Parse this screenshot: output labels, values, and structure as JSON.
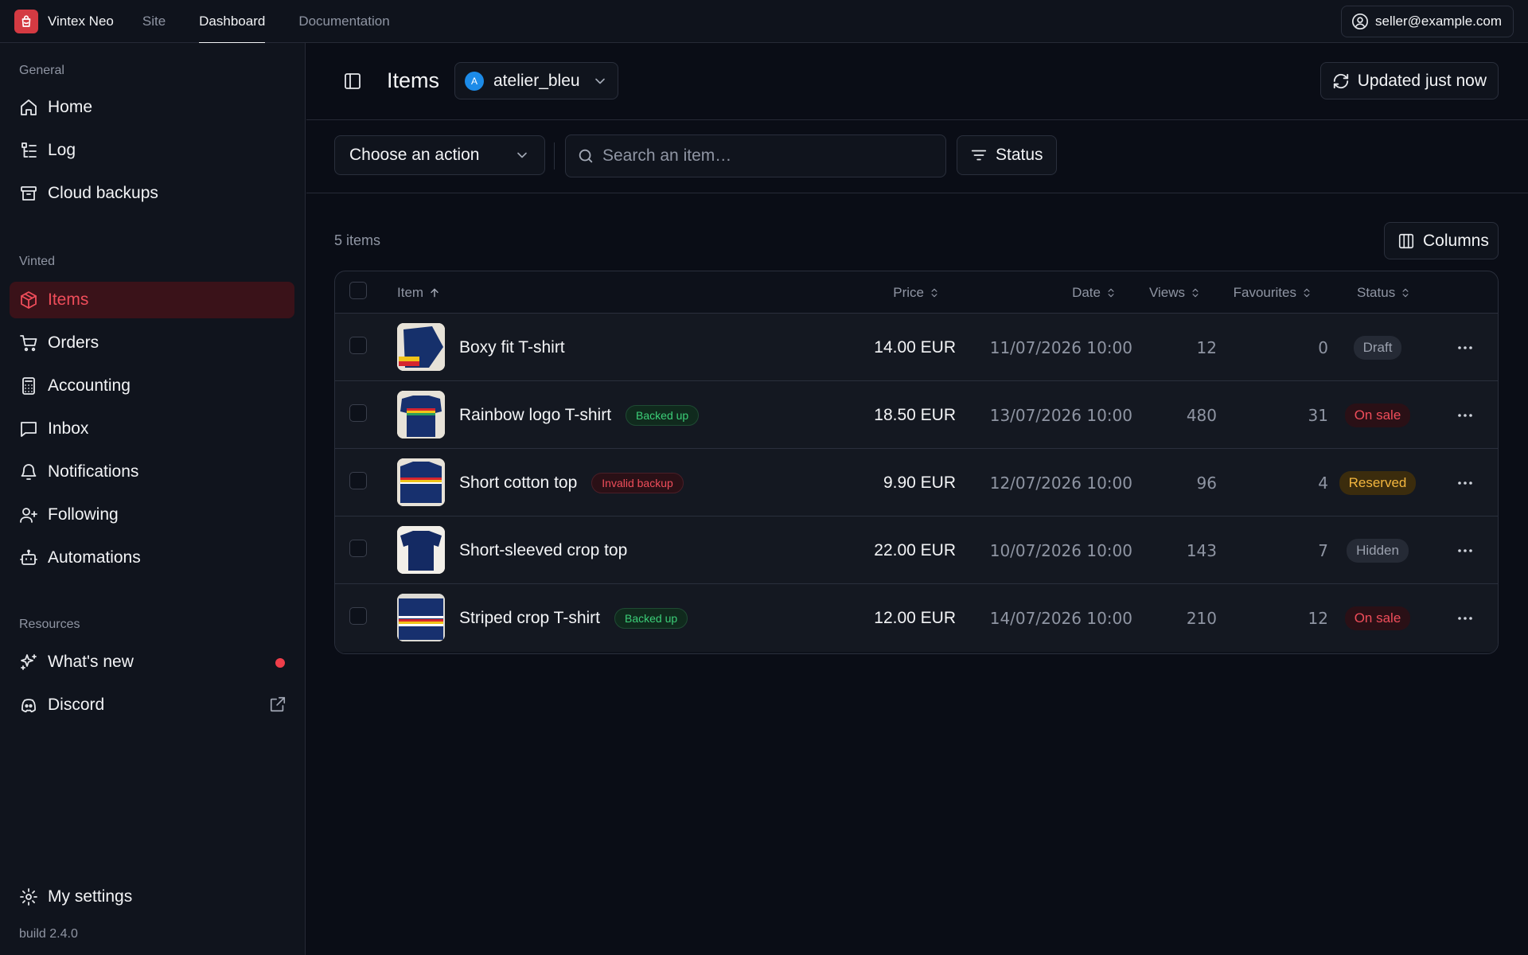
{
  "topnav": {
    "brand": "Vintex Neo",
    "links": [
      "Site",
      "Dashboard",
      "Documentation"
    ],
    "active_link": "Dashboard",
    "account": "seller@example.com"
  },
  "sidebar": {
    "sections": [
      {
        "title": "General",
        "items": [
          {
            "label": "Home",
            "icon": "home-icon"
          },
          {
            "label": "Log",
            "icon": "log-icon"
          },
          {
            "label": "Cloud backups",
            "icon": "archive-icon"
          }
        ]
      },
      {
        "title": "Vinted",
        "items": [
          {
            "label": "Items",
            "icon": "package-icon",
            "active": true
          },
          {
            "label": "Orders",
            "icon": "cart-icon"
          },
          {
            "label": "Accounting",
            "icon": "calculator-icon"
          },
          {
            "label": "Inbox",
            "icon": "message-icon"
          },
          {
            "label": "Notifications",
            "icon": "bell-icon"
          },
          {
            "label": "Following",
            "icon": "user-plus-icon"
          },
          {
            "label": "Automations",
            "icon": "bot-icon"
          }
        ]
      },
      {
        "title": "Resources",
        "items": [
          {
            "label": "What's new",
            "icon": "sparkles-icon"
          },
          {
            "label": "Discord",
            "icon": "discord-icon"
          }
        ]
      }
    ],
    "settings": "My settings",
    "build": "build 2.4.0"
  },
  "header": {
    "title": "Items",
    "account_initial": "A",
    "account_name": "atelier_bleu",
    "refresh_label": "Updated just now"
  },
  "toolbar": {
    "action_placeholder": "Choose an action",
    "search_placeholder": "Search an item…",
    "status_filter": "Status"
  },
  "table": {
    "count_text": "5 items",
    "columns_button": "Columns",
    "headers": {
      "item": "Item",
      "price": "Price",
      "date": "Date",
      "views": "Views",
      "favourites": "Favourites",
      "status": "Status"
    },
    "rows": [
      {
        "name": "Boxy fit T-shirt",
        "tag": "",
        "tag_type": "",
        "price": "14.00 EUR",
        "date": "11/07/2026 10:00",
        "views": "12",
        "favourites": "0",
        "status": "Draft",
        "status_type": "draft"
      },
      {
        "name": "Rainbow logo T-shirt",
        "tag": "Backed up",
        "tag_type": "green",
        "price": "18.50 EUR",
        "date": "13/07/2026 10:00",
        "views": "480",
        "favourites": "31",
        "status": "On sale",
        "status_type": "onsale"
      },
      {
        "name": "Short cotton top",
        "tag": "Invalid backup",
        "tag_type": "red",
        "price": "9.90 EUR",
        "date": "12/07/2026 10:00",
        "views": "96",
        "favourites": "4",
        "status": "Reserved",
        "status_type": "reserved"
      },
      {
        "name": "Short-sleeved crop top",
        "tag": "",
        "tag_type": "",
        "price": "22.00 EUR",
        "date": "10/07/2026 10:00",
        "views": "143",
        "favourites": "7",
        "status": "Hidden",
        "status_type": "hidden"
      },
      {
        "name": "Striped crop T-shirt",
        "tag": "Backed up",
        "tag_type": "green",
        "price": "12.00 EUR",
        "date": "14/07/2026 10:00",
        "views": "210",
        "favourites": "12",
        "status": "On sale",
        "status_type": "onsale"
      }
    ]
  },
  "colors": {
    "accent": "#ef4d5a",
    "brand": "#d43a42",
    "background": "#0a0d16"
  }
}
